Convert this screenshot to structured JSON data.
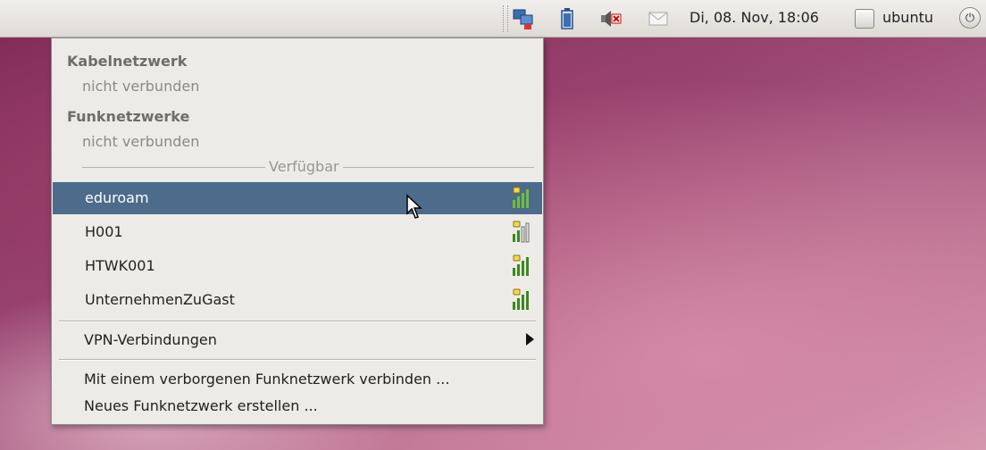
{
  "panel": {
    "clock": "Di, 08. Nov, 18:06",
    "user": "ubuntu",
    "icons": [
      "network-icon",
      "battery-icon",
      "volume-muted-icon",
      "mail-icon",
      "user-icon",
      "power-icon"
    ]
  },
  "menu": {
    "wired": {
      "header": "Kabelnetzwerk",
      "status": "nicht verbunden"
    },
    "wireless": {
      "header": "Funknetzwerke",
      "status": "nicht verbunden"
    },
    "available_label": "Verfügbar",
    "networks": [
      {
        "name": "eduroam",
        "selected": true
      },
      {
        "name": "H001",
        "selected": false
      },
      {
        "name": "HTWK001",
        "selected": false
      },
      {
        "name": "UnternehmenZuGast",
        "selected": false
      }
    ],
    "vpn_label": "VPN-Verbindungen",
    "connect_hidden_label": "Mit einem verborgenen Funknetzwerk verbinden ...",
    "create_new_label": "Neues Funknetzwerk erstellen ..."
  },
  "colors": {
    "selection": "#4d6c8c",
    "menu_bg": "#edebe8",
    "panel_bg": "#e6e3df"
  }
}
